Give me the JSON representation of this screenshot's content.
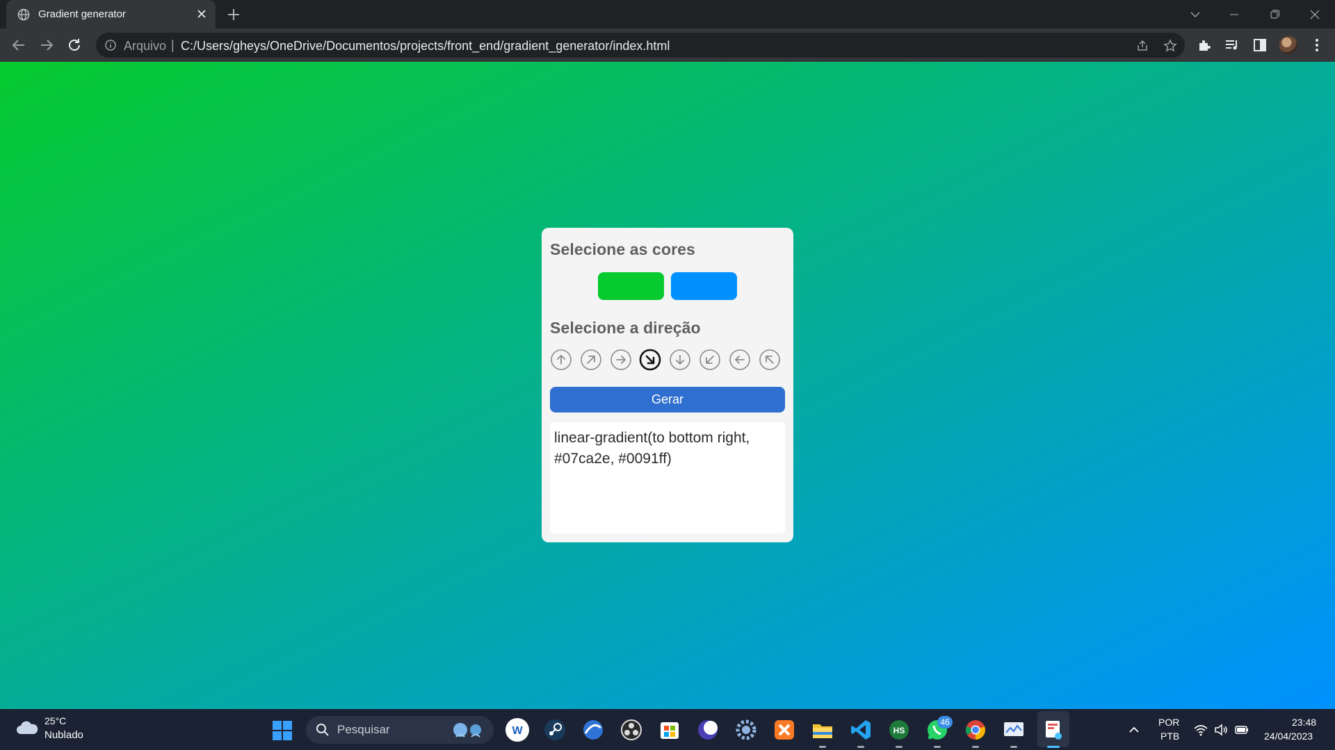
{
  "browser": {
    "tab_title": "Gradient generator",
    "scheme_label": "Arquivo",
    "url": "C:/Users/gheys/OneDrive/Documentos/projects/front_end/gradient_generator/index.html"
  },
  "page": {
    "background": {
      "direction": "to bottom right",
      "from": "#07ca2e",
      "to": "#0091ff"
    },
    "colors_heading": "Selecione as cores",
    "color_1": "#07ca2e",
    "color_2": "#0091ff",
    "direction_heading": "Selecione a direção",
    "directions": [
      {
        "icon": "arrow-up-icon",
        "selected": false
      },
      {
        "icon": "arrow-up-right-icon",
        "selected": false
      },
      {
        "icon": "arrow-right-icon",
        "selected": false
      },
      {
        "icon": "arrow-down-right-icon",
        "selected": true
      },
      {
        "icon": "arrow-down-icon",
        "selected": false
      },
      {
        "icon": "arrow-down-left-icon",
        "selected": false
      },
      {
        "icon": "arrow-left-icon",
        "selected": false
      },
      {
        "icon": "arrow-up-left-icon",
        "selected": false
      }
    ],
    "generate_label": "Gerar",
    "output_text": "linear-gradient(to bottom right, #07ca2e, #0091ff)"
  },
  "taskbar": {
    "temperature": "25°C",
    "weather": "Nublado",
    "search_placeholder": "Pesquisar",
    "whatsapp_badge": "46",
    "lang": "POR",
    "layout": "PTB",
    "time": "23:48",
    "date": "24/04/2023"
  }
}
